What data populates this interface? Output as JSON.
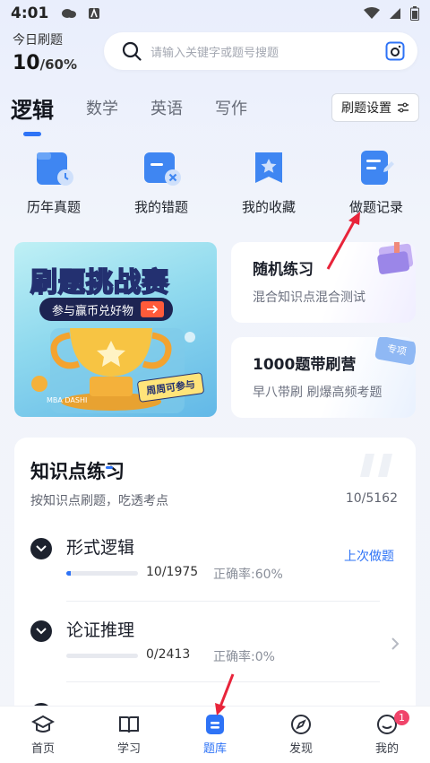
{
  "status_bar": {
    "time": "4:01"
  },
  "daily": {
    "label": "今日刷题",
    "count": "10",
    "total": "/60%"
  },
  "search": {
    "placeholder": "请输入关键字或题号搜题"
  },
  "tabs": [
    {
      "label": "逻辑",
      "active": true
    },
    {
      "label": "数学",
      "active": false
    },
    {
      "label": "英语",
      "active": false
    },
    {
      "label": "写作",
      "active": false
    }
  ],
  "settings_button": {
    "label": "刷题设置"
  },
  "shortcuts": [
    {
      "label": "历年真题",
      "icon": "calendar-folder-icon"
    },
    {
      "label": "我的错题",
      "icon": "wrong-card-icon"
    },
    {
      "label": "我的收藏",
      "icon": "star-bookmark-icon"
    },
    {
      "label": "做题记录",
      "icon": "record-note-icon"
    }
  ],
  "promo": {
    "title": "刷题挑战赛",
    "banner": "参与赢币兑好物",
    "tag": "周周可参与",
    "brand": "MBA DASHI"
  },
  "cards": [
    {
      "title": "随机练习",
      "subtitle": "混合知识点混合测试"
    },
    {
      "title": "1000题带刷营",
      "subtitle": "早八带刷 刷爆高频考题",
      "tag": "专项"
    }
  ],
  "knowledge": {
    "title": "知识点练习",
    "subtitle": "按知识点刷题，吃透考点",
    "count": "10/5162",
    "rows": [
      {
        "title": "形式逻辑",
        "progress": "10/1975",
        "accuracy": "正确率:60%",
        "action": "上次做题",
        "fill": 0.01
      },
      {
        "title": "论证推理",
        "progress": "0/2413",
        "accuracy": "正确率:0%",
        "fill": 0
      }
    ]
  },
  "tabbar": [
    {
      "label": "首页",
      "icon": "graduation-cap-icon"
    },
    {
      "label": "学习",
      "icon": "book-icon"
    },
    {
      "label": "题库",
      "icon": "question-bank-icon",
      "active": true
    },
    {
      "label": "发现",
      "icon": "compass-icon"
    },
    {
      "label": "我的",
      "icon": "profile-chat-icon",
      "badge": "1"
    }
  ],
  "colors": {
    "accent": "#2e73f6",
    "annotation": "#e8243a"
  }
}
